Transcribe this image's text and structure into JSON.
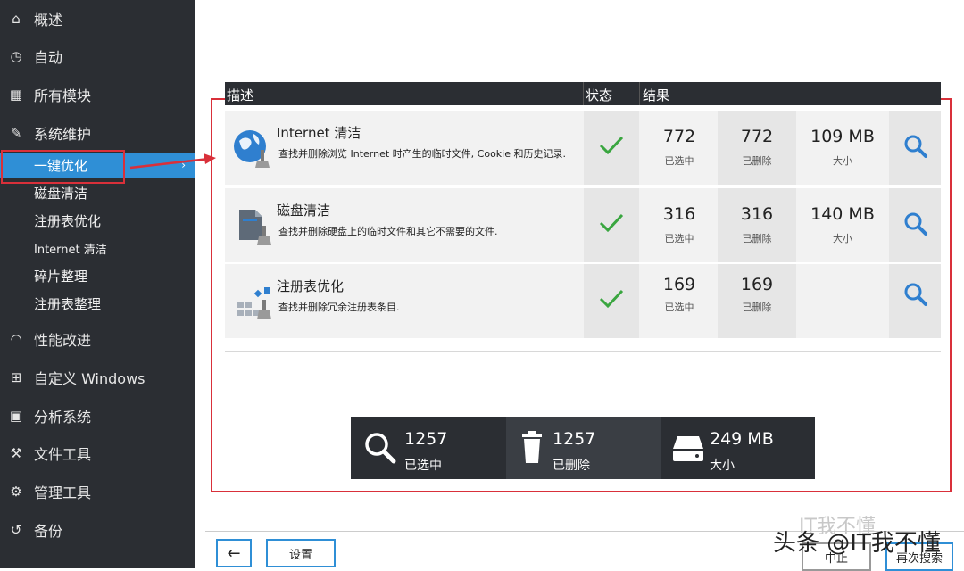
{
  "sidebar": {
    "items": [
      {
        "icon": "home-icon",
        "glyph": "⌂",
        "label": "概述"
      },
      {
        "icon": "auto-icon",
        "glyph": "◷",
        "label": "自动"
      },
      {
        "icon": "modules-icon",
        "glyph": "▦",
        "label": "所有模块"
      },
      {
        "icon": "maintenance-icon",
        "glyph": "✎",
        "label": "系统维护"
      }
    ],
    "sub_items": [
      {
        "label": "一键优化",
        "active": true
      },
      {
        "label": "磁盘清洁"
      },
      {
        "label": "注册表优化"
      },
      {
        "label": "Internet 清洁"
      },
      {
        "label": "碎片整理"
      },
      {
        "label": "注册表整理"
      }
    ],
    "items2": [
      {
        "icon": "performance-icon",
        "glyph": "◠",
        "label": "性能改进"
      },
      {
        "icon": "windows-icon",
        "glyph": "⊞",
        "label": "自定义 Windows"
      },
      {
        "icon": "analyze-icon",
        "glyph": "▣",
        "label": "分析系统"
      },
      {
        "icon": "file-tools-icon",
        "glyph": "⚒",
        "label": "文件工具"
      },
      {
        "icon": "admin-tools-icon",
        "glyph": "⚙",
        "label": "管理工具"
      },
      {
        "icon": "backup-icon",
        "glyph": "↺",
        "label": "备份"
      }
    ]
  },
  "table": {
    "headers": {
      "desc": "描述",
      "status": "状态",
      "result": "结果"
    },
    "rows": [
      {
        "icon": "globe-broom-icon",
        "title": "Internet 清洁",
        "desc": "查找并删除浏览 Internet 时产生的临时文件, Cookie 和历史记录.",
        "selected": "772",
        "selected_label": "已选中",
        "deleted": "772",
        "deleted_label": "已删除",
        "size": "109 MB",
        "size_label": "大小"
      },
      {
        "icon": "disk-broom-icon",
        "title": "磁盘清洁",
        "desc": "查找并删除硬盘上的临时文件和其它不需要的文件.",
        "selected": "316",
        "selected_label": "已选中",
        "deleted": "316",
        "deleted_label": "已删除",
        "size": "140 MB",
        "size_label": "大小"
      },
      {
        "icon": "registry-broom-icon",
        "title": "注册表优化",
        "desc": "查找并删除冗余注册表条目.",
        "selected": "169",
        "selected_label": "已选中",
        "deleted": "169",
        "deleted_label": "已删除"
      }
    ]
  },
  "summary": {
    "selected": "1257",
    "selected_label": "已选中",
    "deleted": "1257",
    "deleted_label": "已删除",
    "size": "249 MB",
    "size_label": "大小"
  },
  "footer": {
    "back_glyph": "←",
    "settings_label": "设置",
    "stop_label": "中止",
    "rescan_label": "再次搜索"
  },
  "watermark": {
    "text": "头条 @IT我不懂",
    "faint": "IT我不懂"
  },
  "colors": {
    "sidebar_bg": "#2b2e33",
    "accent": "#2f8fd6",
    "annotation_red": "#d9303a",
    "check_green": "#3aa640"
  }
}
